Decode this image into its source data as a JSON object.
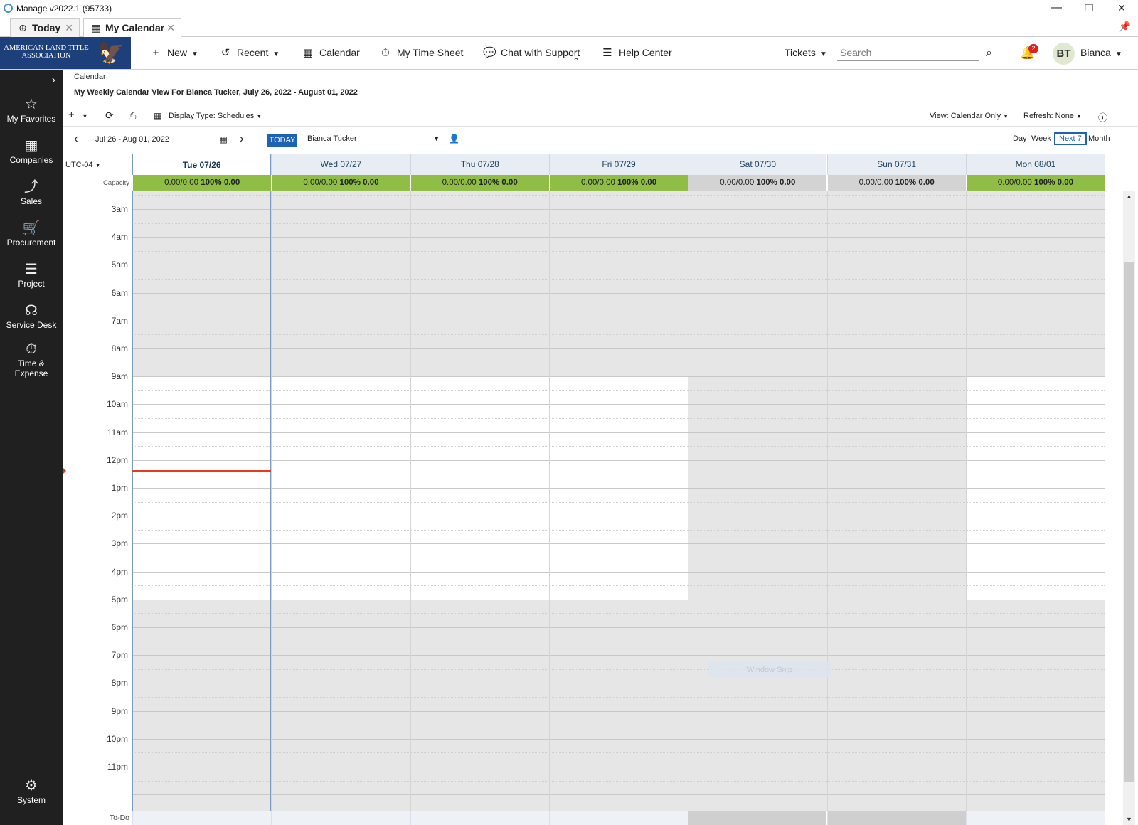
{
  "window": {
    "title": "Manage v2022.1 (95733)",
    "minimize": "—",
    "maximize": "❐",
    "close": "✕"
  },
  "tabs": [
    {
      "label": "Today",
      "icon": "globe-icon",
      "glyph": "⊕",
      "close": "✕"
    },
    {
      "label": "My Calendar",
      "icon": "calendar-icon",
      "glyph": "▦",
      "close": "✕"
    }
  ],
  "pin_glyph": "📌",
  "logo": {
    "line1": "AMERICAN LAND TITLE",
    "line2": "ASSOCIATION",
    "eagle": "🦅"
  },
  "nav": {
    "new": "New",
    "recent": "Recent",
    "calendar": "Calendar",
    "time_sheet": "My Time Sheet",
    "chat": "Chat with Support",
    "help": "Help Center",
    "tickets": "Tickets",
    "search_placeholder": "Search",
    "notifications_count": "2",
    "avatar_initials": "BT",
    "user_name": "Bianca"
  },
  "sidebar": {
    "items": [
      {
        "label": "My Favorites",
        "icon": "star-icon",
        "glyph": "☆"
      },
      {
        "label": "Companies",
        "icon": "building-icon",
        "glyph": "▦"
      },
      {
        "label": "Sales",
        "icon": "chart-icon",
        "glyph": "⤴"
      },
      {
        "label": "Procurement",
        "icon": "cart-icon",
        "glyph": "🛒"
      },
      {
        "label": "Project",
        "icon": "project-icon",
        "glyph": "☰"
      },
      {
        "label": "Service Desk",
        "icon": "headset-icon",
        "glyph": "☊"
      },
      {
        "label": "Time &",
        "label2": "Expense",
        "icon": "timer-icon",
        "glyph": "⏱"
      }
    ],
    "system": {
      "label": "System",
      "icon": "gear-icon",
      "glyph": "⚙"
    }
  },
  "page": {
    "breadcrumb": "Calendar",
    "title": "My Weekly Calendar View For Bianca Tucker, July 26, 2022 - August 01, 2022"
  },
  "toolbar": {
    "display_type": "Display Type: Schedules",
    "view": "View: Calendar Only",
    "refresh": "Refresh: None"
  },
  "nav_bar": {
    "date_range": "Jul 26 - Aug 01, 2022",
    "today_button": "TODAY",
    "member": "Bianca Tucker",
    "views": {
      "day": "Day",
      "week": "Week",
      "next7": "Next 7",
      "month": "Month"
    }
  },
  "calendar": {
    "timezone": "UTC-04",
    "capacity_label": "Capacity",
    "todo_label": "To-Do",
    "days": [
      {
        "label": "Tue 07/26",
        "today": true,
        "weekend": false,
        "cap_left": "0.00/0.00",
        "cap_pct": "100%",
        "cap_right": "0.00"
      },
      {
        "label": "Wed 07/27",
        "today": false,
        "weekend": false,
        "cap_left": "0.00/0.00",
        "cap_pct": "100%",
        "cap_right": "0.00"
      },
      {
        "label": "Thu 07/28",
        "today": false,
        "weekend": false,
        "cap_left": "0.00/0.00",
        "cap_pct": "100%",
        "cap_right": "0.00"
      },
      {
        "label": "Fri 07/29",
        "today": false,
        "weekend": false,
        "cap_left": "0.00/0.00",
        "cap_pct": "100%",
        "cap_right": "0.00"
      },
      {
        "label": "Sat 07/30",
        "today": false,
        "weekend": true,
        "cap_left": "0.00/0.00",
        "cap_pct": "100%",
        "cap_right": "0.00"
      },
      {
        "label": "Sun 07/31",
        "today": false,
        "weekend": true,
        "cap_left": "0.00/0.00",
        "cap_pct": "100%",
        "cap_right": "0.00"
      },
      {
        "label": "Mon 08/01",
        "today": false,
        "weekend": false,
        "cap_left": "0.00/0.00",
        "cap_pct": "100%",
        "cap_right": "0.00"
      }
    ],
    "hours": [
      "3am",
      "4am",
      "5am",
      "6am",
      "7am",
      "8am",
      "9am",
      "10am",
      "11am",
      "12pm",
      "1pm",
      "2pm",
      "3pm",
      "4pm",
      "5pm",
      "6pm",
      "7pm",
      "8pm",
      "9pm",
      "10pm",
      "11pm"
    ],
    "work_start_hour": "9am",
    "work_end_hour": "5pm",
    "current_time_hour": 12.35
  },
  "overlay": {
    "window_snip": "Window Snip"
  }
}
